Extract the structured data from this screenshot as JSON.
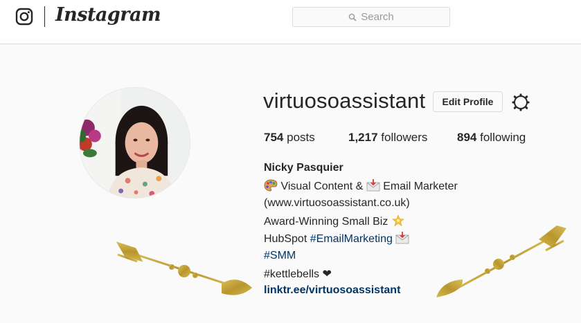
{
  "header": {
    "brand": "Instagram",
    "search_placeholder": "Search"
  },
  "profile": {
    "username": "virtuosoassistant",
    "edit_button": "Edit Profile",
    "stats": {
      "posts_count": "754",
      "posts_label": "posts",
      "followers_count": "1,217",
      "followers_label": "followers",
      "following_count": "894",
      "following_label": "following"
    },
    "bio": {
      "name": "Nicky Pasquier",
      "line1_a": "Visual Content &",
      "line1_b": "Email Marketer",
      "line2": "(www.virtuosoassistant.co.uk)",
      "line3": "Award-Winning Small Biz",
      "line4_a": "HubSpot",
      "line4_tag": "#EmailMarketing",
      "line5_tag": "#SMM",
      "line6": "#kettlebells",
      "heart": "❤",
      "link": "linktr.ee/virtuosoassistant"
    }
  },
  "icons": {
    "instagram": "instagram-glyph-icon",
    "search": "search-icon",
    "settings": "gear-icon",
    "palette": "palette-emoji-icon",
    "envelope": "envelope-emoji-icon",
    "star": "glowing-star-emoji-icon",
    "heart": "heart-emoji-icon",
    "arrow": "gold-arrow-decoration"
  },
  "colors": {
    "hashtag_link": "#003569",
    "gold": "#c9a93a",
    "border": "#dbdbdb"
  }
}
